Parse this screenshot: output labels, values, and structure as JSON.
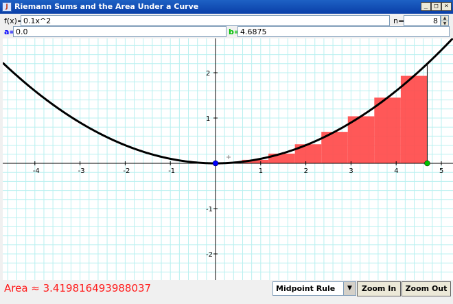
{
  "window": {
    "title": "Riemann Sums and the Area Under a Curve",
    "controls": {
      "minimize": "_",
      "maximize": "□",
      "close": "×"
    }
  },
  "inputs": {
    "f_label": "f(x)=",
    "f_value": "0.1x^2",
    "n_label": "n=",
    "n_value": "8",
    "a_label": "a=",
    "a_value": "0.0",
    "b_label": "b=",
    "b_value": "4.6875"
  },
  "colors": {
    "a_label": "#0000ff",
    "b_label": "#00c000",
    "rect_fill": "#ff4a4a",
    "grid": "#b9f0f0",
    "curve": "#000000",
    "area_text": "#ff1a1a"
  },
  "plot": {
    "function_coefficient": 0.1,
    "a": 0.0,
    "b": 4.6875,
    "n": 8,
    "method": "midpoint",
    "x_range": [
      -4.8,
      5.2
    ],
    "y_range": [
      -2.6,
      2.9
    ],
    "grid_minor_step": 0.2,
    "x_ticks": [
      -4,
      -3,
      -2,
      -1,
      1,
      2,
      3,
      4,
      5
    ],
    "y_ticks": [
      2,
      1,
      -1,
      -2
    ],
    "tick_labels": {
      "x": [
        "-4",
        "-3",
        "-2",
        "-1",
        "1",
        "2",
        "3",
        "4",
        "5"
      ],
      "y": [
        "2",
        "1",
        "-1",
        "-2"
      ]
    }
  },
  "footer": {
    "area_text": "Area ≈ 3.419816493988037",
    "method_options_selected": "Midpoint Rule",
    "zoom_in": "Zoom In",
    "zoom_out": "Zoom Out"
  }
}
